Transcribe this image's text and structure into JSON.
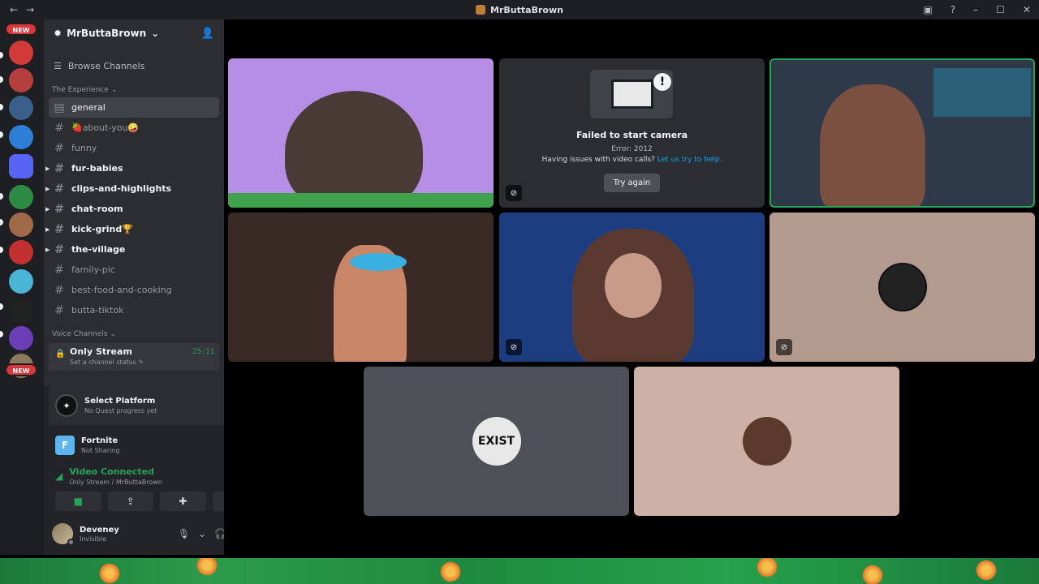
{
  "window": {
    "title": "MrButtaBrown",
    "back_icon": "←",
    "forward_icon": "→",
    "minimize": "–",
    "maximize": "☐",
    "close": "✕",
    "help": "?"
  },
  "servers": {
    "new_label_top": "NEW",
    "new_label_bottom": "NEW",
    "icons": [
      {
        "color": "#d23a3a"
      },
      {
        "color": "#b53f3f"
      },
      {
        "color": "#3a5f8a"
      },
      {
        "color": "#2d7fd6"
      },
      {
        "color": "#5865f2"
      },
      {
        "color": "#2d8a45"
      },
      {
        "color": "#a06a4a"
      },
      {
        "color": "#c23030"
      },
      {
        "color": "#49b6d6"
      },
      {
        "color": "#222"
      },
      {
        "color": "#6a3fb6"
      },
      {
        "color": "#8a7b5f"
      }
    ]
  },
  "guild": {
    "name": "MrButtaBrown",
    "browse_channels": "Browse Channels",
    "category_text": "The Experience",
    "category_voice": "Voice Channels",
    "channels": [
      {
        "name": "general",
        "unread": false,
        "active": true,
        "arrow": false
      },
      {
        "name": "🍓about-you🤪",
        "unread": false,
        "active": false,
        "arrow": false
      },
      {
        "name": "funny",
        "unread": false,
        "active": false,
        "arrow": false
      },
      {
        "name": "fur-babies",
        "unread": true,
        "active": false,
        "arrow": true
      },
      {
        "name": "clips-and-highlights",
        "unread": true,
        "active": false,
        "arrow": true
      },
      {
        "name": "chat-room",
        "unread": true,
        "active": false,
        "arrow": true
      },
      {
        "name": "kick-grind🏆",
        "unread": true,
        "active": false,
        "arrow": true
      },
      {
        "name": "the-village",
        "unread": true,
        "active": false,
        "arrow": true
      },
      {
        "name": "family-pic",
        "unread": false,
        "active": false,
        "arrow": false
      },
      {
        "name": "best-food-and-cooking",
        "unread": false,
        "active": false,
        "arrow": false
      },
      {
        "name": "butta-tiktok",
        "unread": false,
        "active": false,
        "arrow": false
      }
    ],
    "voice_channel": {
      "name": "Only Stream",
      "status": "Set a channel status",
      "time": "25:11"
    }
  },
  "panels": {
    "quest_title": "Select Platform",
    "quest_sub": "No Quest progress yet",
    "activity_title": "Fortnite",
    "activity_sub": "Not Sharing",
    "rtc_title": "Video Connected",
    "rtc_sub": "Only Stream / MrButtaBrown",
    "user_name": "Deveney",
    "user_status": "Invisible"
  },
  "stage": {
    "camera_error": {
      "title": "Failed to start camera",
      "code": "Error: 2012",
      "help_text": "Having issues with video calls?",
      "help_link": "Let us try to help.",
      "button": "Try again"
    },
    "tile_colors": {
      "video1": "#b68ee6",
      "video3": "#2e3a4a",
      "video4": "#3a2a26",
      "video5": "#1c3e80",
      "avatar6": "#b39a8f",
      "avatar7": "#4e5058",
      "avatar8": "#cdb1a7"
    },
    "avatar_text": "EXIST"
  }
}
